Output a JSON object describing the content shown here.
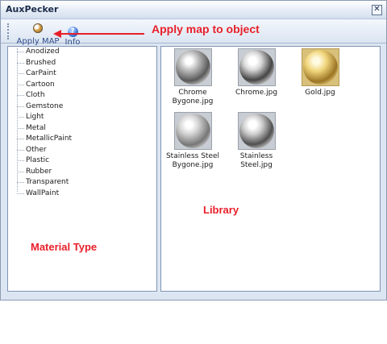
{
  "window": {
    "title": "AuxPecker",
    "close_glyph": "✕"
  },
  "toolbar": {
    "apply_label": "Apply MAP",
    "apply_icon": "apply-map-icon",
    "info_label": "Info",
    "info_icon": "info-icon",
    "info_glyph": "?"
  },
  "annotations": {
    "apply": "Apply map to object",
    "material_type": "Material Type",
    "library": "Library",
    "color": "#e8202a"
  },
  "material_types": [
    "Anodized",
    "Brushed",
    "CarPaint",
    "Cartoon",
    "Cloth",
    "Gemstone",
    "Light",
    "Metal",
    "MetallicPaint",
    "Other",
    "Plastic",
    "Rubber",
    "Transparent",
    "WallPaint"
  ],
  "library": [
    {
      "name": "Chrome Bygone.jpg",
      "line1": "Chrome",
      "line2": "Bygone.jpg"
    },
    {
      "name": "Chrome.jpg",
      "line1": "Chrome.jpg",
      "line2": ""
    },
    {
      "name": "Gold.jpg",
      "line1": "Gold.jpg",
      "line2": ""
    },
    {
      "name": "Stainless Steel Bygone.jpg",
      "line1": "Stainless Steel",
      "line2": "Bygone.jpg"
    },
    {
      "name": "Stainless Steel.jpg",
      "line1": "Stainless Steel.jpg",
      "line2": ""
    }
  ]
}
